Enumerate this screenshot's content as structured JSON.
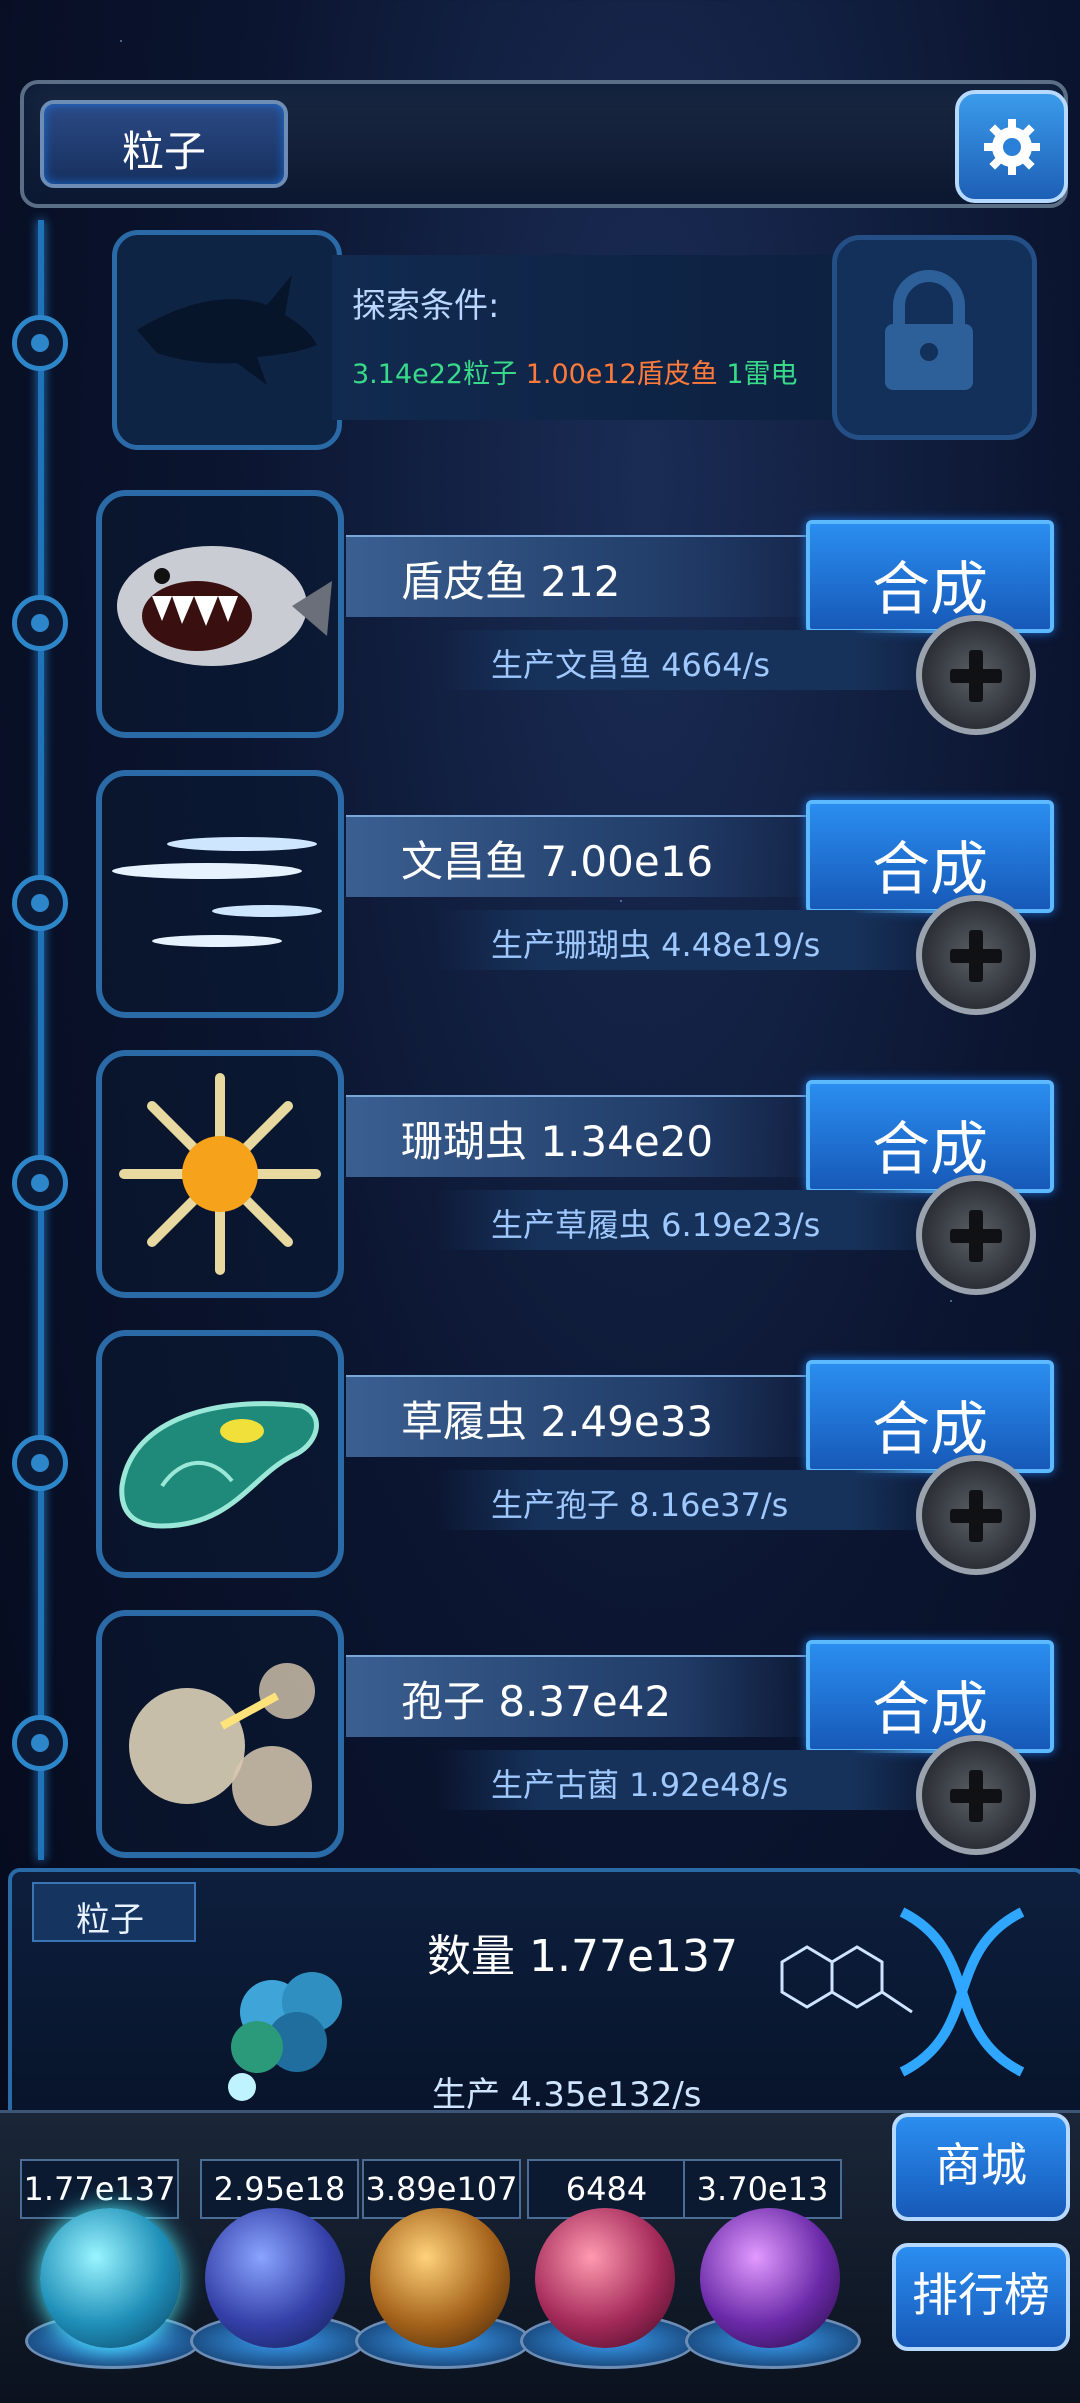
{
  "header": {
    "tab_label": "粒子"
  },
  "locked": {
    "explore_label": "探索条件:",
    "requirements": [
      "3.14e22粒子",
      "1.00e12盾皮鱼",
      "1雷电"
    ],
    "colors": [
      "#39d98a",
      "#ff7a3a",
      "#39d98a"
    ]
  },
  "creatures": [
    {
      "name": "盾皮鱼 212",
      "merge_label": "合成",
      "production": "生产文昌鱼 4664/s",
      "icon": "placoderm-fish-icon"
    },
    {
      "name": "文昌鱼 7.00e16",
      "merge_label": "合成",
      "production": "生产珊瑚虫 4.48e19/s",
      "icon": "lancelet-fish-icon"
    },
    {
      "name": "珊瑚虫 1.34e20",
      "merge_label": "合成",
      "production": "生产草履虫 6.19e23/s",
      "icon": "coral-polyp-icon"
    },
    {
      "name": "草履虫 2.49e33",
      "merge_label": "合成",
      "production": "生产孢子 8.16e37/s",
      "icon": "paramecium-icon"
    },
    {
      "name": "孢子 8.37e42",
      "merge_label": "合成",
      "production": "生产古菌 1.92e48/s",
      "icon": "spore-icon"
    }
  ],
  "stats_panel": {
    "tab_label": "粒子",
    "quantity": "数量 1.77e137",
    "production": "生产 4.35e132/s"
  },
  "resources": [
    {
      "value": "1.77e137",
      "icon": "particle-orb-icon"
    },
    {
      "value": "2.95e18",
      "icon": "lightning-orb-icon"
    },
    {
      "value": "3.89e107",
      "icon": "nebula-orb-icon"
    },
    {
      "value": "6484",
      "icon": "brain-orb-icon"
    },
    {
      "value": "3.70e13",
      "icon": "vortex-orb-icon"
    }
  ],
  "side_buttons": {
    "shop": "商城",
    "leaderboard": "排行榜"
  },
  "accent_color": "#1f73b8"
}
